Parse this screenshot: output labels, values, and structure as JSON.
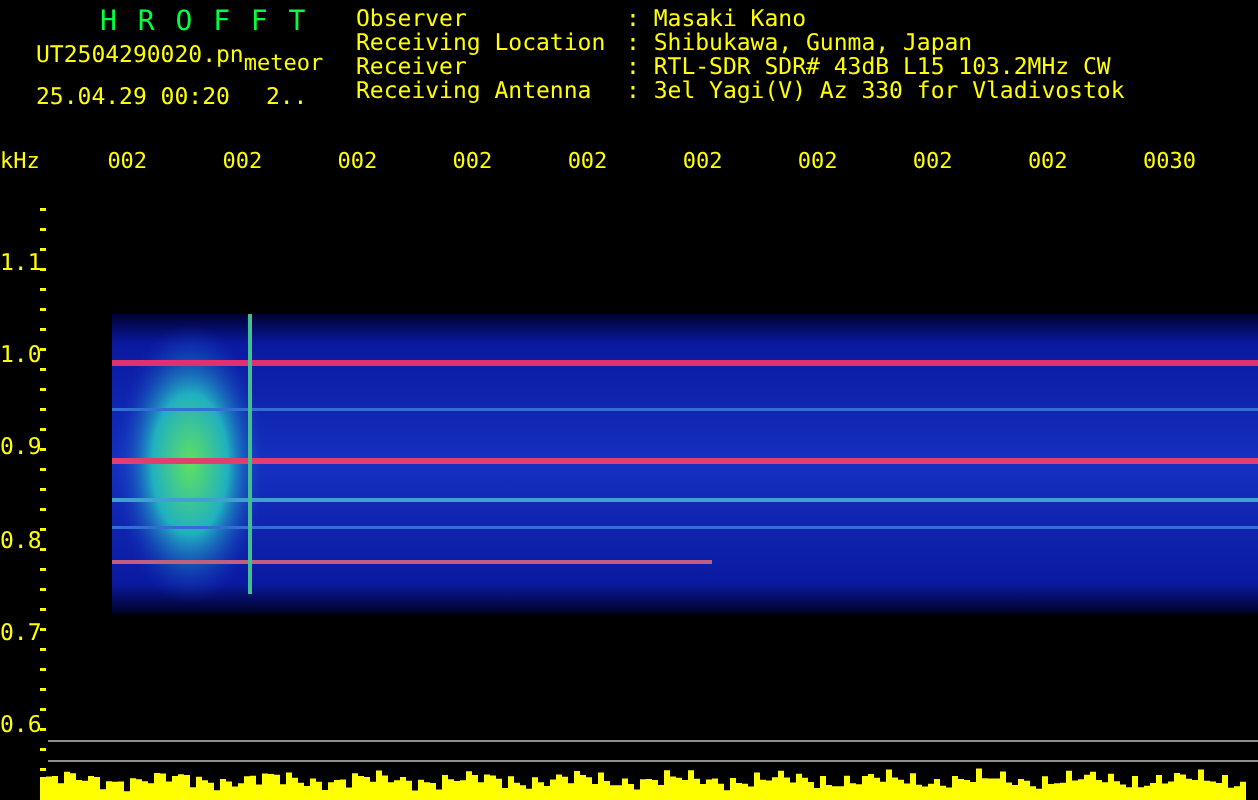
{
  "logo": "H R O F F T",
  "file": {
    "name": "UT2504290020.pn",
    "tag": "meteor",
    "datetime": "25.04.29 00:20",
    "extra": "2.."
  },
  "info": [
    {
      "label": "Observer",
      "value": ": Masaki Kano"
    },
    {
      "label": "Receiving Location",
      "value": ": Shibukawa, Gunma, Japan"
    },
    {
      "label": "Receiver",
      "value": ": RTL-SDR SDR# 43dB L15 103.2MHz CW"
    },
    {
      "label": "Receiving Antenna",
      "value": ": 3el Yagi(V) Az 330 for Vladivostok"
    }
  ],
  "x_axis": {
    "labels": [
      "002",
      "002",
      "002",
      "002",
      "002",
      "002",
      "002",
      "002",
      "002",
      "0030"
    ]
  },
  "y_axis": {
    "unit": "kHz",
    "labels": [
      "1.1",
      "1.0",
      "0.9",
      "0.8",
      "0.7",
      "0.6"
    ]
  }
}
